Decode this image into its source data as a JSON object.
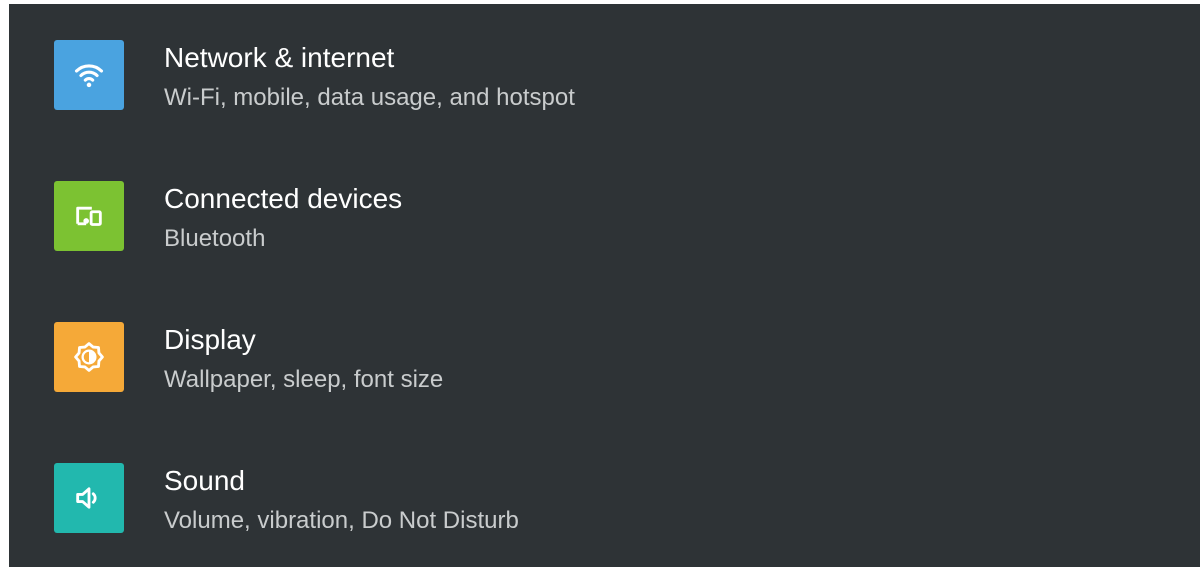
{
  "settings": {
    "items": [
      {
        "title": "Network & internet",
        "subtitle": "Wi-Fi, mobile, data usage, and hotspot",
        "icon": "wifi-icon",
        "color": "#4aa3e0"
      },
      {
        "title": "Connected devices",
        "subtitle": "Bluetooth",
        "icon": "devices-icon",
        "color": "#7cc232"
      },
      {
        "title": "Display",
        "subtitle": "Wallpaper, sleep, font size",
        "icon": "brightness-icon",
        "color": "#f5a938"
      },
      {
        "title": "Sound",
        "subtitle": "Volume, vibration, Do Not Disturb",
        "icon": "volume-icon",
        "color": "#22b8ae"
      }
    ]
  }
}
